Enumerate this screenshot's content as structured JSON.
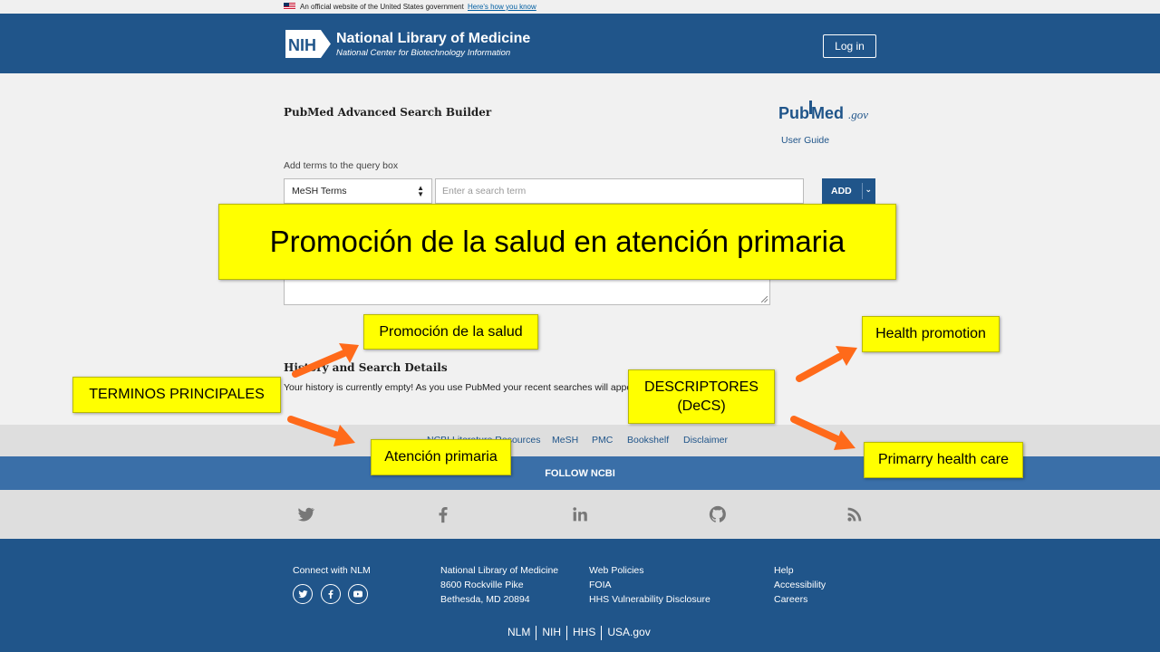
{
  "gov_banner": {
    "official_text": "An official website of the United States government",
    "how_you_know": "Here's how you know"
  },
  "header": {
    "logo_text": "NIH",
    "title": "National Library of Medicine",
    "subtitle": "National Center for Biotechnology Information",
    "login_label": "Log in"
  },
  "builder": {
    "title": "PubMed Advanced Search Builder",
    "logo_pub": "Pub",
    "logo_med": "Med",
    "logo_gov": ".gov",
    "user_guide": "User Guide",
    "add_terms_label": "Add terms to the query box",
    "field_selected": "MeSH Terms",
    "search_placeholder": "Enter a search term",
    "add_label": "ADD"
  },
  "history": {
    "title": "History and Search Details",
    "empty_text": "Your history is currently empty! As you use PubMed your recent searches will appear here."
  },
  "footer": {
    "links": [
      "NCBI Literature Resources",
      "MeSH",
      "PMC",
      "Bookshelf",
      "Disclaimer"
    ],
    "follow_label": "FOLLOW NCBI",
    "connect_label": "Connect with NLM",
    "address": [
      "National Library of Medicine",
      "8600 Rockville Pike",
      "Bethesda, MD 20894"
    ],
    "policies": [
      "Web Policies",
      "FOIA",
      "HHS Vulnerability Disclosure"
    ],
    "help": [
      "Help",
      "Accessibility",
      "Careers"
    ],
    "gov_links": [
      "NLM",
      "NIH",
      "HHS",
      "USA.gov"
    ]
  },
  "annotations": {
    "main_banner": "Promoción de la salud en atención primaria",
    "promocion": "Promoción de la salud",
    "health_promotion": "Health promotion",
    "terminos": "TERMINOS PRINCIPALES",
    "descriptores": "DESCRIPTORES\n(DeCS)",
    "atencion": "Atención primaria",
    "primary_care": "Primarry health care"
  },
  "colors": {
    "header_blue": "#20558a",
    "annotation_yellow": "#ffff00",
    "arrow_orange": "#ff6a1a"
  }
}
